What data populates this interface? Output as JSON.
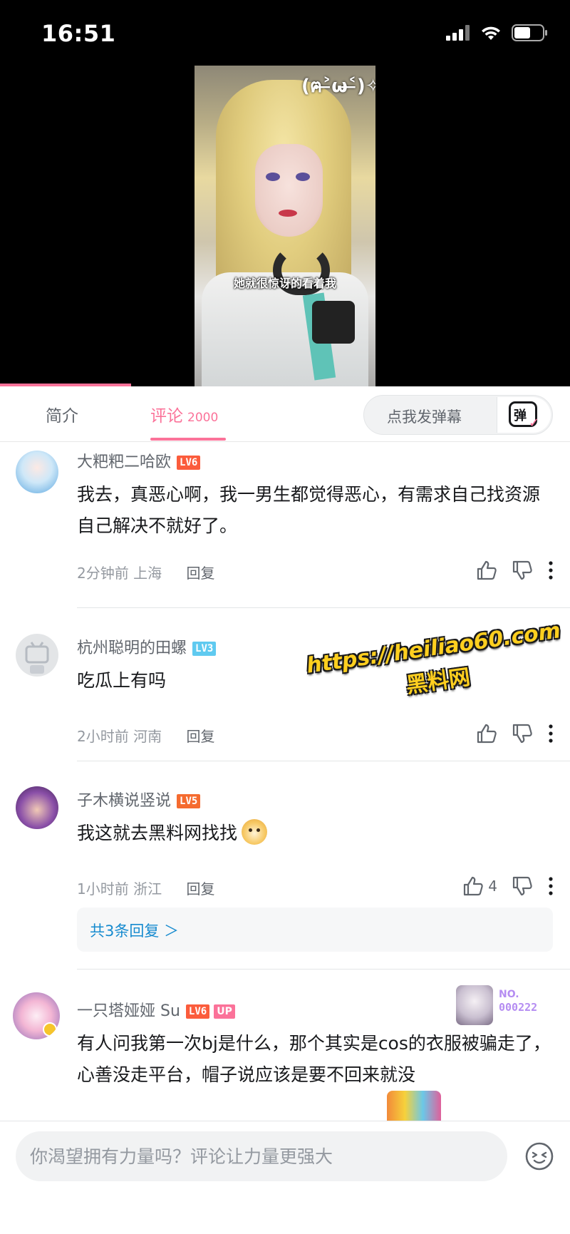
{
  "status_bar": {
    "time": "16:51"
  },
  "video": {
    "overlay_top": "(ฅ˃̶ω˂̶)✧",
    "subtitle": "她就很惊讶的看着我",
    "progress": 0.23
  },
  "tabs": {
    "intro": "简介",
    "comments": "评论",
    "comments_count": "2000",
    "danmaku_placeholder": "点我发弹幕",
    "danmaku_icon_label": "弹"
  },
  "comments": [
    {
      "username": "大粑粑二哈欧",
      "level": "LV6",
      "level_color": "#fb5c3c",
      "text": "我去，真恶心啊，我一男生都觉得恶心，有需求自己找资源自己解决不就好了。",
      "time": "2分钟前",
      "location": "上海",
      "reply_label": "回复"
    },
    {
      "username": "杭州聪明的田螺",
      "level": "LV3",
      "level_color": "#5fcaf0",
      "text": "吃瓜上有吗",
      "time": "2小时前",
      "location": "河南",
      "reply_label": "回复"
    },
    {
      "username": "子木横说竖说",
      "level": "LV5",
      "level_color": "#f56b2f",
      "text": "我这就去黑料网找找",
      "time": "1小时前",
      "location": "浙江",
      "reply_label": "回复",
      "likes": "4",
      "replies_summary": "共3条回复 ＞"
    },
    {
      "username": "一只塔娅娅 Su",
      "level": "LV6",
      "level_color": "#fb5c3c",
      "up_badge": "UP",
      "badge_no": "NO.",
      "badge_number": "000222",
      "text": "有人问我第一次bj是什么，那个其实是cos的衣服被骗走了，心善没走平台，帽子说应该是要不回来就没"
    }
  ],
  "watermark": {
    "url": "https://heiliao60.com",
    "name": "黑料网"
  },
  "input": {
    "placeholder": "你渴望拥有力量吗？评论让力量更强大"
  },
  "icons": {
    "signal": "signal-icon",
    "wifi": "wifi-icon",
    "battery": "battery-icon",
    "like": "thumb-up-icon",
    "dislike": "thumb-down-icon",
    "more": "more-vertical-icon",
    "emoji": "emoji-icon"
  },
  "colors": {
    "accent": "#fb7299",
    "link": "#178bcf",
    "watermark": "#ffcf1f"
  }
}
